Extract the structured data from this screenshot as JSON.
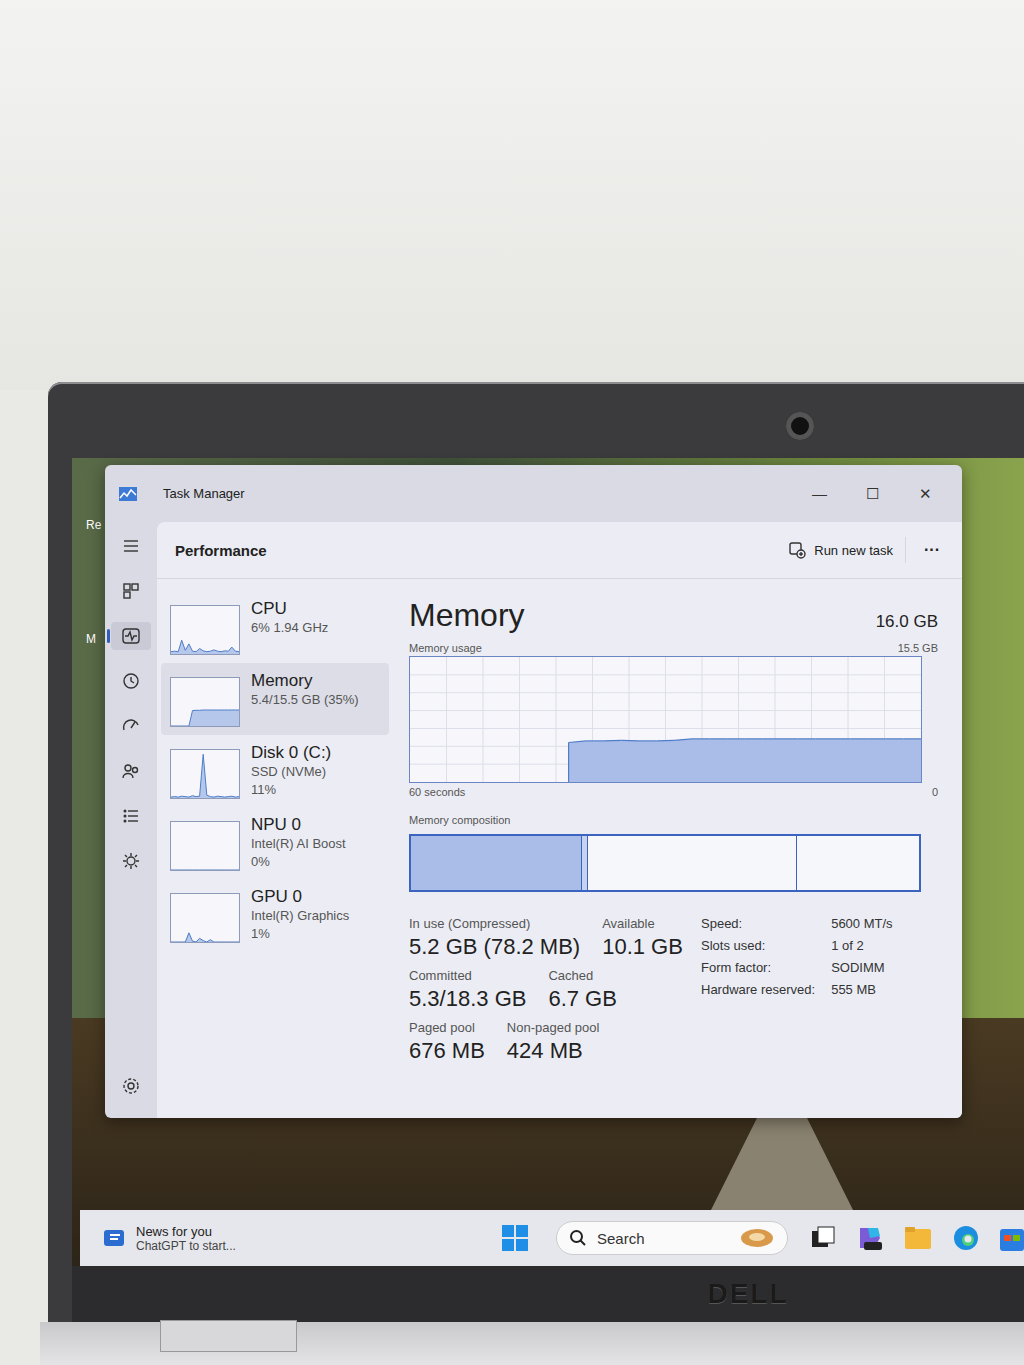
{
  "desktop": {
    "icons": [
      "Re",
      "M"
    ]
  },
  "window": {
    "title": "Task Manager",
    "controls": [
      "—",
      "☐",
      "✕"
    ]
  },
  "nav": {
    "items": [
      {
        "selected": false
      },
      {
        "selected": false
      },
      {
        "selected": true
      },
      {
        "selected": false
      },
      {
        "selected": false
      },
      {
        "selected": false
      },
      {
        "selected": false
      },
      {
        "selected": false
      }
    ]
  },
  "header": {
    "title": "Performance",
    "run_new_task": "Run new task",
    "more": "···"
  },
  "devices": [
    {
      "name": "CPU",
      "lines": [
        "6% 1.94 GHz"
      ],
      "selected": false,
      "max": 100,
      "values": [
        5,
        6,
        5,
        30,
        8,
        22,
        6,
        5,
        12,
        7,
        5,
        6,
        9,
        6,
        5,
        7,
        6,
        15,
        6,
        5
      ]
    },
    {
      "name": "Memory",
      "lines": [
        "5.4/15.5 GB (35%)"
      ],
      "selected": true,
      "max": 15.5,
      "values": [
        0,
        0,
        0,
        0,
        0,
        0,
        5.2,
        5.3,
        5.3,
        5.4,
        5.4,
        5.4,
        5.4,
        5.4,
        5.4,
        5.4,
        5.4,
        5.4,
        5.4,
        5.4
      ]
    },
    {
      "name": "Disk 0 (C:)",
      "lines": [
        "SSD (NVMe)",
        "11%"
      ],
      "selected": false,
      "max": 100,
      "values": [
        2,
        3,
        2,
        4,
        3,
        2,
        5,
        3,
        4,
        95,
        6,
        3,
        2,
        4,
        3,
        2,
        3,
        4,
        2,
        3
      ]
    },
    {
      "name": "NPU 0",
      "lines": [
        "Intel(R) AI Boost",
        "0%"
      ],
      "selected": false,
      "max": 100,
      "values": [
        0,
        0,
        0,
        0,
        0,
        0,
        0,
        0,
        0,
        0,
        0,
        0,
        0,
        0,
        0,
        0,
        0,
        0,
        0,
        0
      ]
    },
    {
      "name": "GPU 0",
      "lines": [
        "Intel(R) Graphics",
        "1%"
      ],
      "selected": false,
      "max": 100,
      "values": [
        0,
        0,
        0,
        0,
        0,
        20,
        2,
        0,
        8,
        3,
        0,
        5,
        0,
        0,
        0,
        0,
        0,
        0,
        0,
        0
      ]
    }
  ],
  "detail": {
    "title": "Memory",
    "total": "16.0 GB",
    "usage_label": "Memory usage",
    "usage_max": "15.5 GB",
    "usage_max_value": 15.5,
    "usage_values": [
      0,
      0,
      0,
      0,
      0,
      0,
      0,
      0,
      0,
      4.9,
      5.1,
      5.1,
      5.15,
      5.1,
      5.1,
      5.15,
      5.35,
      5.35,
      5.35,
      5.35,
      5.35,
      5.35,
      5.35,
      5.35,
      5.35,
      5.35,
      5.35,
      5.35,
      5.35,
      5.35
    ],
    "time_label": "60 seconds",
    "time_end": "0",
    "composition_label": "Memory composition",
    "composition": [
      {
        "level": 0.335,
        "color": "#a9bde8"
      },
      {
        "level": 0.012,
        "color": "#c6d3f0"
      },
      {
        "level": 0.41,
        "color": "#f6f7fb"
      },
      {
        "level": 0.243,
        "color": "#f6f7fb"
      }
    ],
    "stats": [
      [
        {
          "label": "In use (Compressed)",
          "value": "5.2 GB (78.2 MB)"
        },
        {
          "label": "Available",
          "value": "10.1 GB"
        }
      ],
      [
        {
          "label": "Committed",
          "value": "5.3/18.3 GB"
        },
        {
          "label": "Cached",
          "value": "6.7 GB"
        }
      ],
      [
        {
          "label": "Paged pool",
          "value": "676 MB"
        },
        {
          "label": "Non-paged pool",
          "value": "424 MB"
        }
      ]
    ],
    "specs": [
      {
        "label": "Speed:",
        "value": "5600 MT/s"
      },
      {
        "label": "Slots used:",
        "value": "1 of 2"
      },
      {
        "label": "Form factor:",
        "value": "SODIMM"
      },
      {
        "label": "Hardware reserved:",
        "value": "555 MB"
      }
    ]
  },
  "taskbar": {
    "news_title": "News for you",
    "news_text": "ChatGPT to start...",
    "search": "Search"
  },
  "laptop": {
    "brand": "DELL"
  }
}
